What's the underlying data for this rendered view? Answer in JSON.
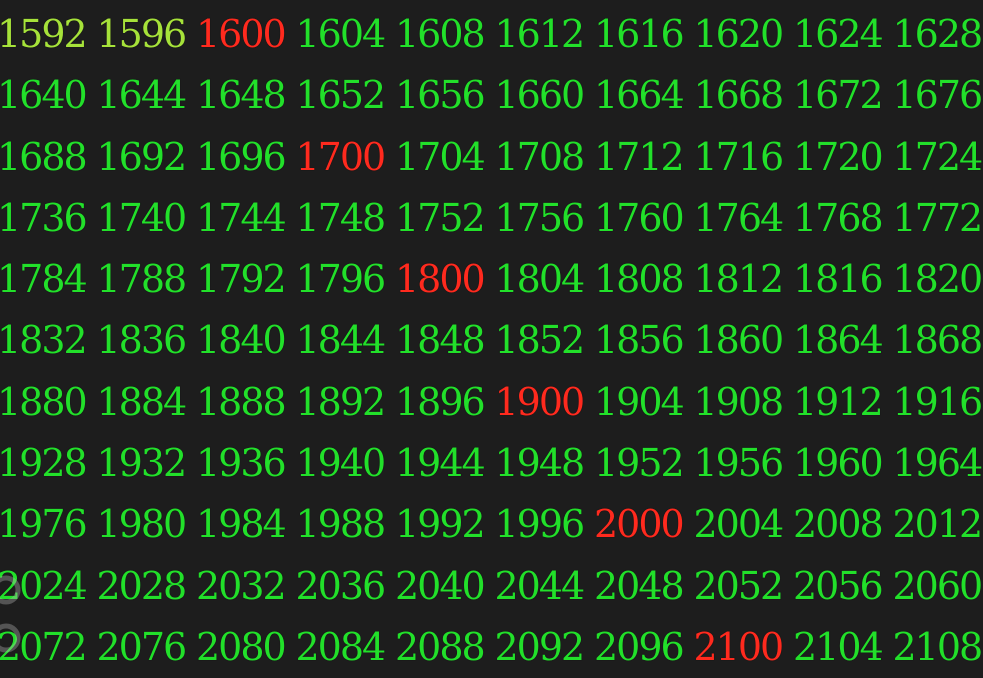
{
  "colors": {
    "background": "#1d1d1d",
    "normal": "#22e02a",
    "highlight": "#ff2a1e",
    "lime": "#a6e23a"
  },
  "rows": [
    [
      "1592",
      "1596",
      "1600",
      "1604",
      "1608",
      "1612",
      "1616",
      "1620",
      "1624",
      "1628"
    ],
    [
      "1640",
      "1644",
      "1648",
      "1652",
      "1656",
      "1660",
      "1664",
      "1668",
      "1672",
      "1676"
    ],
    [
      "1688",
      "1692",
      "1696",
      "1700",
      "1704",
      "1708",
      "1712",
      "1716",
      "1720",
      "1724"
    ],
    [
      "1736",
      "1740",
      "1744",
      "1748",
      "1752",
      "1756",
      "1760",
      "1764",
      "1768",
      "1772"
    ],
    [
      "1784",
      "1788",
      "1792",
      "1796",
      "1800",
      "1804",
      "1808",
      "1812",
      "1816",
      "1820"
    ],
    [
      "1832",
      "1836",
      "1840",
      "1844",
      "1848",
      "1852",
      "1856",
      "1860",
      "1864",
      "1868"
    ],
    [
      "1880",
      "1884",
      "1888",
      "1892",
      "1896",
      "1900",
      "1904",
      "1908",
      "1912",
      "1916"
    ],
    [
      "1928",
      "1932",
      "1936",
      "1940",
      "1944",
      "1948",
      "1952",
      "1956",
      "1960",
      "1964"
    ],
    [
      "1976",
      "1980",
      "1984",
      "1988",
      "1992",
      "1996",
      "2000",
      "2004",
      "2008",
      "2012"
    ],
    [
      "2024",
      "2028",
      "2032",
      "2036",
      "2040",
      "2044",
      "2048",
      "2052",
      "2056",
      "2060"
    ],
    [
      "2072",
      "2076",
      "2080",
      "2084",
      "2088",
      "2092",
      "2096",
      "2100",
      "2104",
      "2108"
    ]
  ],
  "highlighted": [
    "1600",
    "1700",
    "1800",
    "1900",
    "2000",
    "2100"
  ],
  "lime_values": [
    "1592",
    "1596"
  ],
  "watermark_icon": "gear-icon"
}
